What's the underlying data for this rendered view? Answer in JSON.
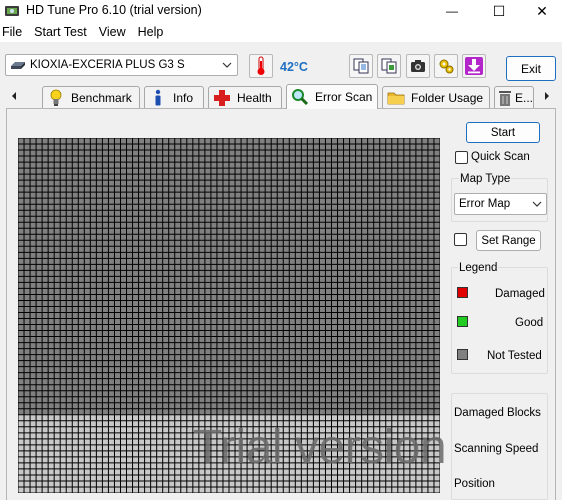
{
  "window": {
    "title": "HD Tune Pro 6.10 (trial version)",
    "minimize_glyph": "—",
    "maximize_glyph": "☐",
    "close_glyph": "✕"
  },
  "menu": [
    "File",
    "Start Test",
    "View",
    "Help"
  ],
  "toolbar": {
    "drive": "KIOXIA-EXCERIA PLUS G3 S",
    "temperature": "42°C",
    "exit_label": "Exit"
  },
  "tabs": [
    {
      "label": "Benchmark",
      "icon": "lightbulb-icon"
    },
    {
      "label": "Info",
      "icon": "info-icon"
    },
    {
      "label": "Health",
      "icon": "health-cross-icon"
    },
    {
      "label": "Error Scan",
      "icon": "magnifier-icon",
      "active": true
    },
    {
      "label": "Folder Usage",
      "icon": "folder-icon"
    },
    {
      "label": "E...",
      "icon": "trash-icon"
    }
  ],
  "controls": {
    "start_label": "Start",
    "quick_scan_label": "Quick Scan",
    "map_type_label": "Map Type",
    "map_type_value": "Error Map",
    "set_range_label": "Set Range",
    "legend_label": "Legend",
    "legend": [
      {
        "label": "Damaged",
        "color": "#e00000"
      },
      {
        "label": "Good",
        "color": "#22cc22"
      },
      {
        "label": "Not Tested",
        "color": "#808080"
      }
    ],
    "stats": [
      "Damaged Blocks",
      "Scanning Speed",
      "Position"
    ]
  },
  "blockmap": {
    "cols": 70,
    "rows": 59,
    "dark_rows": 46,
    "dark_color": "#808080",
    "light_color": "#c8c8c8",
    "grid_color": "#000000"
  },
  "watermark": "Trial version",
  "colors": {
    "accent": "#1e6fc0"
  }
}
